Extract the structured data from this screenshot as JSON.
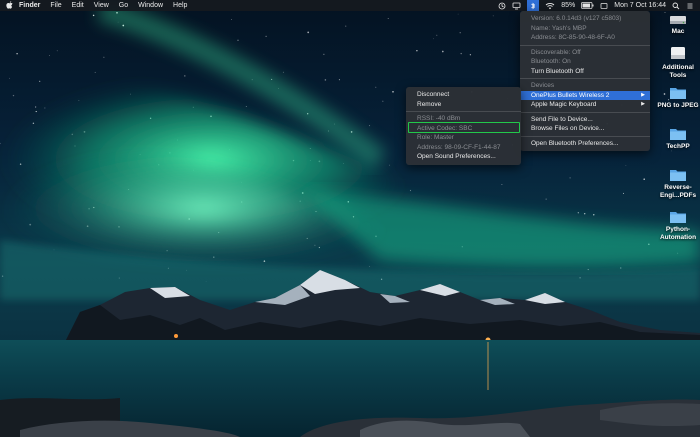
{
  "menubar": {
    "apple_glyph": "",
    "items": [
      "Finder",
      "File",
      "Edit",
      "View",
      "Go",
      "Window",
      "Help"
    ],
    "battery_percent": "85%",
    "datetime": "Mon 7 Oct 16:44"
  },
  "bluetooth_menu": {
    "info": [
      "Version: 6.0.14d3 (v127 c5803)",
      "Name: Yash's MBP",
      "Address: 8C-85-90-48-6F-A0"
    ],
    "status": [
      "Discoverable: Off",
      "Bluetooth: On"
    ],
    "toggle_label": "Turn Bluetooth Off",
    "devices_header": "Devices",
    "devices": [
      "OnePlus Bullets Wireless 2",
      "Apple Magic Keyboard"
    ],
    "actions": [
      "Send File to Device...",
      "Browse Files on Device..."
    ],
    "preferences_label": "Open Bluetooth Preferences..."
  },
  "device_submenu": {
    "actions": [
      "Disconnect",
      "Remove"
    ],
    "details": [
      "RSSI: -40 dBm",
      "Active Codec: SBC",
      "Role: Master",
      "Address: 98-09-CF-F1-44-87"
    ],
    "sound_prefs_label": "Open Sound Preferences..."
  },
  "desktop_icons": [
    {
      "label": "Mac",
      "type": "drive"
    },
    {
      "label": "Additional Tools",
      "type": "drive"
    },
    {
      "label": "PNG to JPEG",
      "type": "folder"
    },
    {
      "label": "TechPP",
      "type": "folder"
    },
    {
      "label": "Reverse-Engi...PDFs",
      "type": "folder"
    },
    {
      "label": "Python-Automation",
      "type": "folder"
    }
  ],
  "colors": {
    "menu_highlight": "#2f6fd6",
    "codec_outline": "#22c94a",
    "folder_blue": "#5aa6e6"
  }
}
